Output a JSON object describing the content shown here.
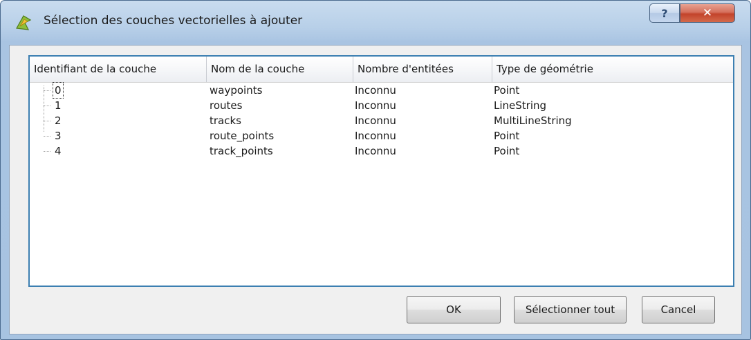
{
  "window": {
    "title": "Sélection des couches vectorielles à ajouter",
    "help_glyph": "?",
    "close_glyph": "✕"
  },
  "table": {
    "columns": [
      "Identifiant de la couche",
      "Nom de la couche",
      "Nombre d'entitées",
      "Type de géométrie"
    ],
    "rows": [
      {
        "id": "0",
        "name": "waypoints",
        "count": "Inconnu",
        "geometry": "Point"
      },
      {
        "id": "1",
        "name": "routes",
        "count": "Inconnu",
        "geometry": "LineString"
      },
      {
        "id": "2",
        "name": "tracks",
        "count": "Inconnu",
        "geometry": "MultiLineString"
      },
      {
        "id": "3",
        "name": "route_points",
        "count": "Inconnu",
        "geometry": "Point"
      },
      {
        "id": "4",
        "name": "track_points",
        "count": "Inconnu",
        "geometry": "Point"
      }
    ]
  },
  "buttons": {
    "ok": "OK",
    "select_all": "Sélectionner tout",
    "cancel": "Cancel"
  },
  "icons": {
    "app": "qgis-icon",
    "help": "help-icon",
    "close": "close-icon"
  },
  "colors": {
    "accent_border": "#3c7fb1",
    "close_button": "#c2432b"
  }
}
